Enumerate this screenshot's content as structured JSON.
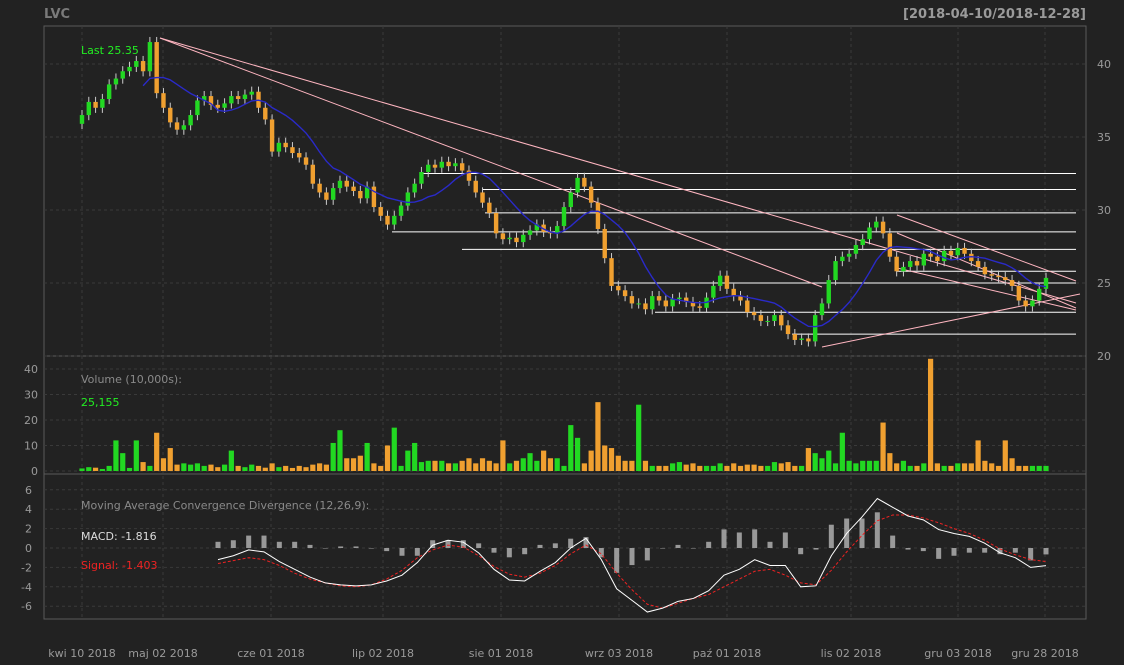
{
  "symbol": "LVC",
  "date_range": "[2018-04-10/2018-12-28]",
  "colors": {
    "background": "#222222",
    "up": "#22d822",
    "down": "#f0a030",
    "ma": "#2a2ac8",
    "trend": "#ffb6c1",
    "level": "#ffffff",
    "grid": "#3a3a3a",
    "axis_text": "#9a9a9a",
    "green_text": "#22ee22",
    "red_text": "#ee2222",
    "macd_line": "#ffffff",
    "signal_line": "#ee2222",
    "hist": "#999999"
  },
  "price_panel": {
    "last_label": "Last 25.35",
    "y_ticks": [
      "20",
      "25",
      "30",
      "35",
      "40"
    ],
    "ylim": [
      20,
      42
    ]
  },
  "volume_panel": {
    "title": "Volume (10,000s):",
    "last_value": "25,155",
    "y_ticks": [
      "0",
      "10",
      "20",
      "30",
      "40"
    ],
    "ylim": [
      0,
      44
    ]
  },
  "macd_panel": {
    "title": "Moving Average Convergence Divergence (12,26,9):",
    "macd_label": "MACD: -1.816",
    "signal_label": "Signal: -1.403",
    "y_ticks": [
      "-6",
      "-4",
      "-2",
      "0",
      "2",
      "4",
      "6"
    ],
    "ylim": [
      -7,
      7
    ]
  },
  "x_ticks": [
    "kwi 10 2018",
    "maj 02 2018",
    "cze 01 2018",
    "lip 02 2018",
    "sie 01 2018",
    "wrz 03 2018",
    "paź 01 2018",
    "lis 02 2018",
    "gru 03 2018",
    "gru 28 2018"
  ],
  "chart_data": {
    "type": "candlestick",
    "x_start": "2018-04-10",
    "x_end": "2018-12-28",
    "close_series": [
      36.5,
      37.4,
      37.0,
      37.6,
      38.6,
      39.0,
      39.5,
      39.8,
      40.2,
      39.5,
      41.5,
      38.0,
      37.0,
      36.0,
      35.5,
      35.8,
      36.5,
      37.5,
      37.8,
      37.2,
      37.0,
      37.3,
      37.8,
      37.6,
      37.9,
      38.1,
      37.0,
      36.2,
      34.0,
      34.6,
      34.3,
      33.9,
      33.6,
      33.1,
      31.8,
      31.2,
      30.7,
      31.5,
      32.0,
      31.6,
      31.3,
      30.8,
      31.6,
      30.2,
      29.6,
      29.0,
      29.6,
      30.3,
      31.2,
      31.8,
      32.6,
      33.1,
      32.9,
      33.3,
      33.0,
      33.2,
      32.7,
      32.0,
      31.2,
      30.5,
      29.8,
      28.4,
      28.0,
      28.1,
      27.8,
      28.3,
      28.6,
      29.0,
      28.5,
      28.4,
      28.9,
      30.2,
      31.2,
      32.2,
      31.6,
      30.5,
      28.7,
      26.7,
      24.8,
      24.5,
      24.1,
      23.6,
      23.6,
      23.2,
      24.1,
      23.8,
      23.4,
      23.9,
      24.0,
      23.7,
      23.4,
      23.3,
      24.0,
      24.8,
      25.5,
      24.6,
      24.1,
      23.8,
      23.0,
      22.8,
      22.4,
      22.4,
      22.8,
      22.1,
      21.5,
      21.1,
      21.2,
      21.0,
      22.8,
      23.6,
      25.2,
      26.5,
      26.8,
      27.0,
      27.6,
      28.0,
      28.8,
      29.2,
      28.4,
      26.8,
      25.8,
      26.1,
      26.5,
      26.2,
      27.0,
      26.8,
      26.5,
      27.2,
      26.9,
      27.4,
      27.0,
      26.5,
      26.1,
      25.6,
      25.5,
      25.4,
      25.2,
      24.8,
      23.8,
      23.4,
      23.8,
      24.6,
      25.35
    ],
    "volume_10k": [
      1,
      1.5,
      1.3,
      0.8,
      2,
      12,
      7,
      1.2,
      12,
      3.5,
      2,
      15,
      5,
      9,
      2.5,
      3,
      2.5,
      3,
      2,
      2.5,
      1.5,
      2.5,
      8,
      2,
      1.5,
      2.5,
      2,
      1.3,
      3,
      1.5,
      2,
      1.2,
      2,
      1.5,
      2.5,
      3,
      2.5,
      11,
      16,
      5,
      5,
      6,
      11,
      3,
      2,
      10,
      17,
      2,
      8,
      11,
      3.5,
      4,
      4,
      4,
      3,
      3,
      4,
      5,
      3,
      5,
      4,
      3,
      12,
      3,
      4,
      5,
      7,
      4,
      8,
      5,
      5,
      2,
      18,
      13,
      3,
      8,
      27,
      10,
      9,
      6,
      4,
      4,
      26,
      4,
      2,
      2,
      2,
      3,
      3.5,
      2.5,
      3,
      2,
      2,
      2,
      3,
      2,
      3,
      2,
      2.5,
      2.5,
      2,
      2,
      3.5,
      3,
      3.5,
      2,
      2,
      9,
      7,
      5,
      8,
      3,
      15,
      4,
      3,
      4,
      4,
      4,
      19,
      7,
      3,
      4,
      2,
      2,
      3,
      44,
      3,
      2,
      2,
      3,
      3,
      3,
      12,
      4,
      3,
      2,
      12,
      5,
      2,
      2,
      2,
      2,
      2,
      3.5,
      3.5,
      3,
      2.5,
      3
    ],
    "macd_approx": [
      -1.2,
      -0.8,
      -0.2,
      -0.4,
      -1.4,
      -2.2,
      -3.0,
      -3.6,
      -3.8,
      -3.9,
      -3.8,
      -3.4,
      -2.8,
      -1.5,
      0.3,
      0.8,
      0.6,
      -0.5,
      -2.2,
      -3.3,
      -3.4,
      -2.4,
      -1.5,
      0.0,
      1.0,
      -1.2,
      -4.2,
      -5.4,
      -6.6,
      -6.2,
      -5.5,
      -5.2,
      -4.4,
      -2.8,
      -2.2,
      -1.2,
      -1.8,
      -1.8,
      -4.0,
      -3.9,
      -0.8,
      1.5,
      3.2,
      5.1,
      4.2,
      3.3,
      2.9,
      1.9,
      1.5,
      1.2,
      0.5,
      -0.5,
      -1.0,
      -2.0,
      -1.816
    ],
    "signal_approx": [
      -1.6,
      -1.3,
      -1.0,
      -1.2,
      -1.8,
      -2.6,
      -3.2,
      -3.6,
      -3.9,
      -4.0,
      -3.8,
      -3.2,
      -2.3,
      -1.0,
      -0.2,
      0.3,
      0.1,
      -0.8,
      -1.9,
      -2.7,
      -3.0,
      -2.6,
      -1.8,
      -0.6,
      0.3,
      -0.6,
      -2.6,
      -4.3,
      -5.8,
      -6.2,
      -5.7,
      -5.2,
      -4.8,
      -4.0,
      -3.2,
      -2.4,
      -2.2,
      -2.8,
      -3.6,
      -3.8,
      -2.3,
      -0.4,
      1.3,
      2.8,
      3.4,
      3.4,
      3.1,
      2.6,
      2.0,
      1.5,
      0.8,
      -0.1,
      -0.7,
      -1.2,
      -1.403
    ]
  }
}
